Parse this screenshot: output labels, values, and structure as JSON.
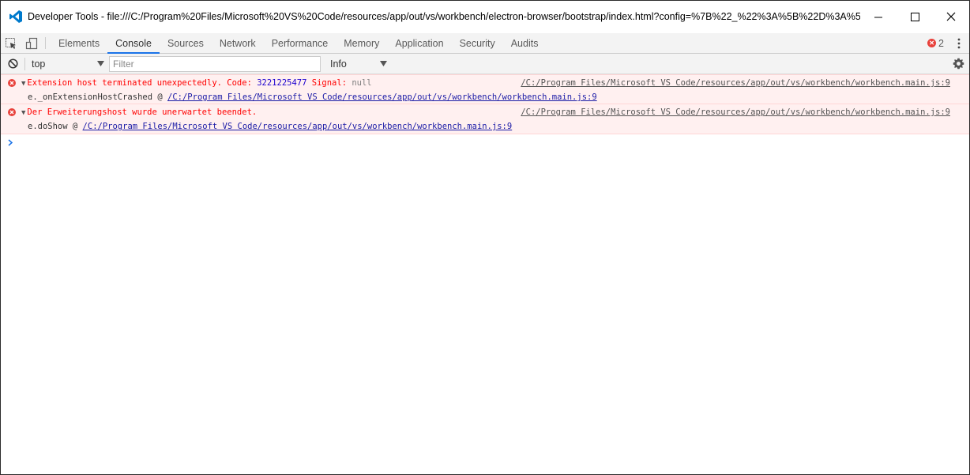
{
  "window": {
    "title": "Developer Tools - file:///C:/Program%20Files/Microsoft%20VS%20Code/resources/app/out/vs/workbench/electron-browser/bootstrap/index.html?config=%7B%22_%22%3A%5B%22D%3A%5C%5C...",
    "controls": [
      "minimize-icon",
      "maximize-icon",
      "close-icon"
    ]
  },
  "tabs": [
    "Elements",
    "Console",
    "Sources",
    "Network",
    "Performance",
    "Memory",
    "Application",
    "Security",
    "Audits"
  ],
  "active_tab": "Console",
  "error_count": "2",
  "toolbar": {
    "context": "top",
    "filter_placeholder": "Filter",
    "level": "Info"
  },
  "messages": [
    {
      "text": "Extension host terminated unexpectedly. Code: ",
      "code": "3221225477",
      "signal_label": "Signal: ",
      "signal_value": "null",
      "source": "/C:/Program Files/Microsoft VS Code/resources/app/out/vs/workbench/workbench.main.js:9",
      "trace_fn": "e._onExtensionHostCrashed @ ",
      "trace_link": "/C:/Program Files/Microsoft VS Code/resources/app/out/vs/workbench/workbench.main.js:9"
    },
    {
      "text": "Der Erweiterungshost wurde unerwartet beendet.",
      "source": "/C:/Program Files/Microsoft VS Code/resources/app/out/vs/workbench/workbench.main.js:9",
      "trace_fn": "e.doShow @ ",
      "trace_link": "/C:/Program Files/Microsoft VS Code/resources/app/out/vs/workbench/workbench.main.js:9"
    }
  ],
  "colors": {
    "error_text": "#ff0000",
    "error_bg": "#fff0f0",
    "accent": "#1a73e8"
  }
}
